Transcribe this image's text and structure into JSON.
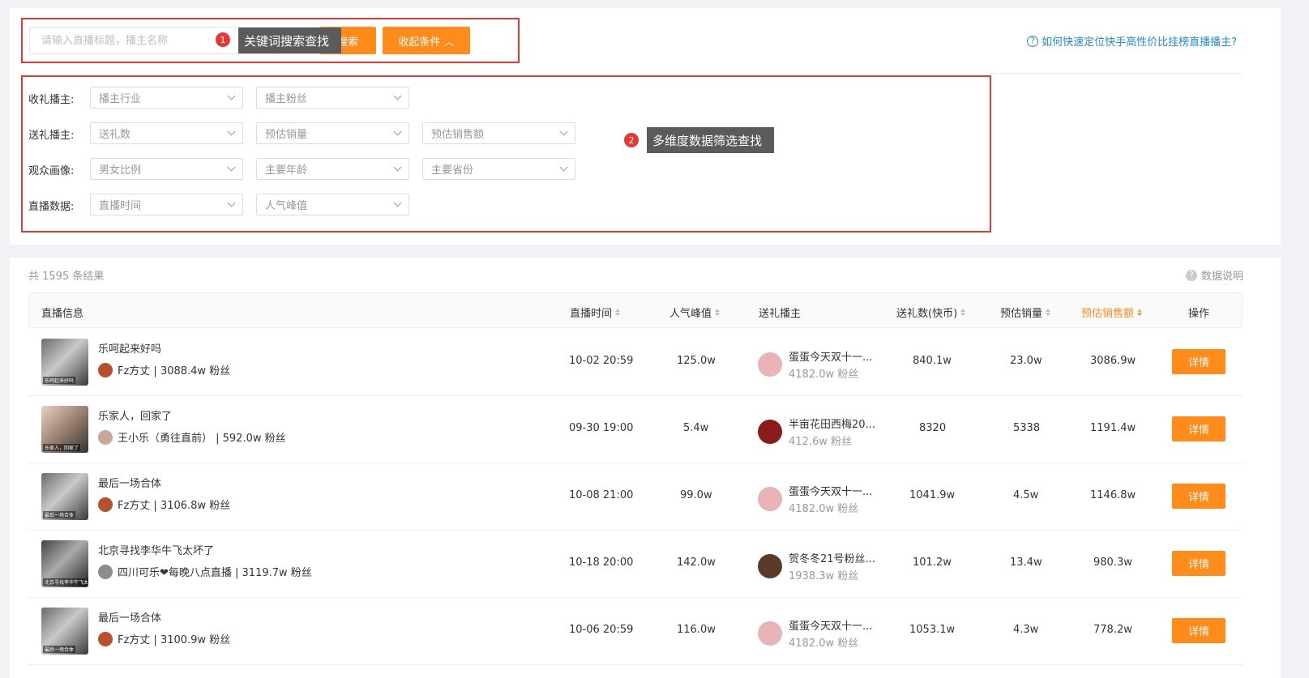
{
  "search": {
    "placeholder": "请输入直播标题，播主名称",
    "search_label": "搜索",
    "collapse_label": "收起条件"
  },
  "help_link": "如何快速定位快手高性价比挂榜直播播主?",
  "annotations": {
    "one": {
      "num": "1",
      "text": "关键词搜索查找"
    },
    "two": {
      "num": "2",
      "text": "多维度数据筛选查找"
    }
  },
  "filters": [
    {
      "label": "收礼播主:",
      "dropdowns": [
        "播主行业",
        "播主粉丝"
      ]
    },
    {
      "label": "送礼播主:",
      "dropdowns": [
        "送礼数",
        "预估销量",
        "预估销售额"
      ]
    },
    {
      "label": "观众画像:",
      "dropdowns": [
        "男女比例",
        "主要年龄",
        "主要省份"
      ]
    },
    {
      "label": "直播数据:",
      "dropdowns": [
        "直播时间",
        "人气峰值"
      ]
    }
  ],
  "results": {
    "count_text": "共 1595 条结果",
    "note": "数据说明"
  },
  "table": {
    "headers": {
      "info": "直播信息",
      "time": "直播时间",
      "peak": "人气峰值",
      "gifter": "送礼播主",
      "gifts": "送礼数(快币)",
      "sales": "预估销量",
      "revenue": "预估销售额",
      "action": "操作"
    },
    "detail_label": "详情",
    "rows": [
      {
        "thumb_caption": "乐呵起来好吗",
        "title": "乐呵起来好吗",
        "streamer": "Fz方丈 | 3088.4w 粉丝",
        "time": "10-02 20:59",
        "peak": "125.0w",
        "gifter_name": "蛋蛋今天双十一...",
        "gifter_fans": "4182.0w 粉丝",
        "gifts": "840.1w",
        "sales": "23.0w",
        "revenue": "3086.9w"
      },
      {
        "thumb_caption": "乐家人，回家了",
        "title": "乐家人，回家了",
        "streamer": "王小乐（勇往直前） | 592.0w 粉丝",
        "time": "09-30 19:00",
        "peak": "5.4w",
        "gifter_name": "半亩花田西梅20...",
        "gifter_fans": "412.6w 粉丝",
        "gifts": "8320",
        "sales": "5338",
        "revenue": "1191.4w"
      },
      {
        "thumb_caption": "最后一场合体",
        "title": "最后一场合体",
        "streamer": "Fz方丈 | 3106.8w 粉丝",
        "time": "10-08 21:00",
        "peak": "99.0w",
        "gifter_name": "蛋蛋今天双十一...",
        "gifter_fans": "4182.0w 粉丝",
        "gifts": "1041.9w",
        "sales": "4.5w",
        "revenue": "1146.8w"
      },
      {
        "thumb_caption": "北京寻找李华牛飞太坏了",
        "title": "北京寻找李华牛飞太坏了",
        "streamer": "四川可乐❤每晚八点直播 | 3119.7w 粉丝",
        "time": "10-18 20:00",
        "peak": "142.0w",
        "gifter_name": "贺冬冬21号粉丝...",
        "gifter_fans": "1938.3w 粉丝",
        "gifts": "101.2w",
        "sales": "13.4w",
        "revenue": "980.3w"
      },
      {
        "thumb_caption": "最后一场合体",
        "title": "最后一场合体",
        "streamer": "Fz方丈 | 3100.9w 粉丝",
        "time": "10-06 20:59",
        "peak": "116.0w",
        "gifter_name": "蛋蛋今天双十一...",
        "gifter_fans": "4182.0w 粉丝",
        "gifts": "1053.1w",
        "sales": "4.3w",
        "revenue": "778.2w"
      }
    ]
  },
  "colors": {
    "accent": "#ff8c1a",
    "link": "#1e88e5",
    "annotation": "#e53935"
  }
}
